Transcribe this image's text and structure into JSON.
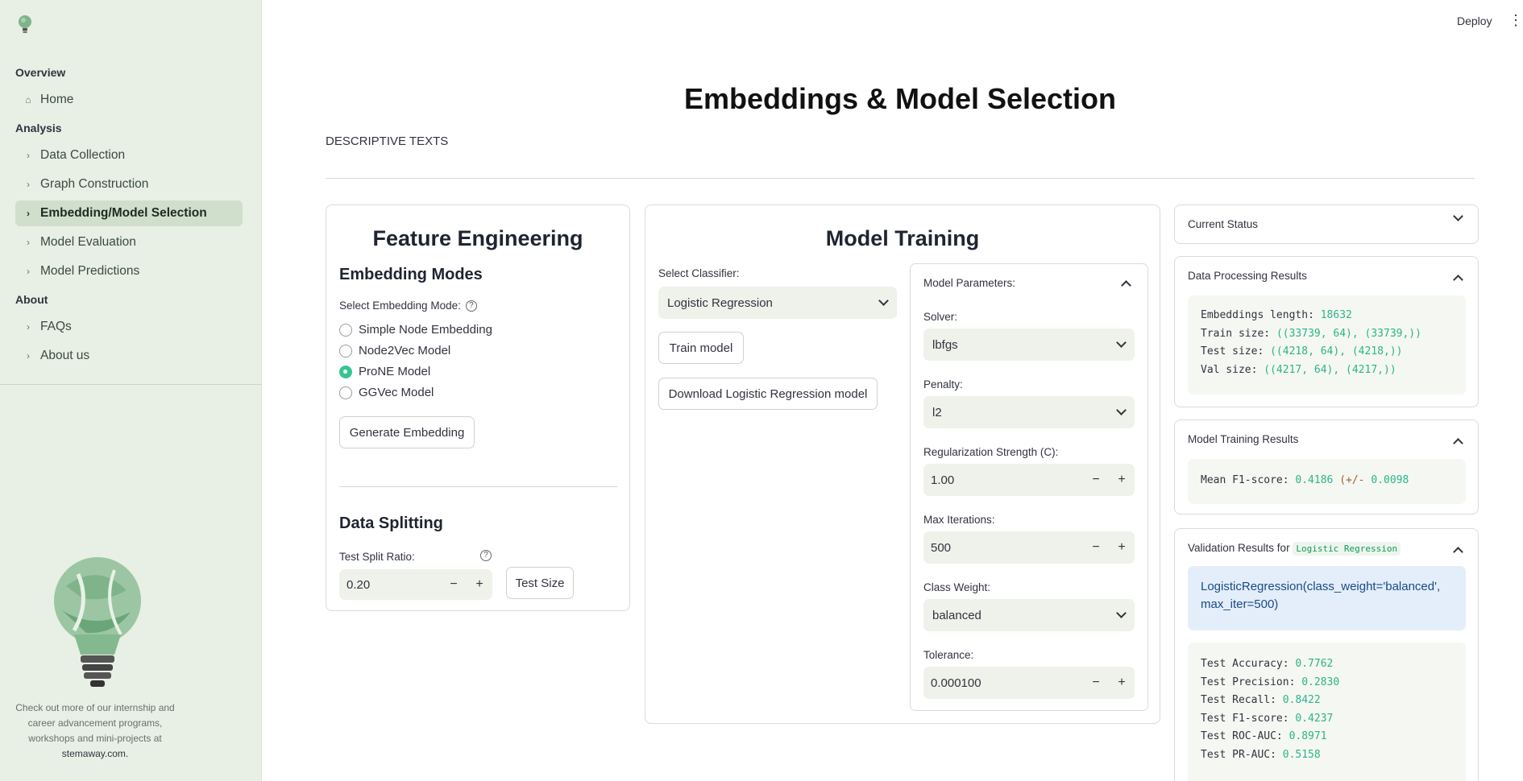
{
  "header": {
    "deploy_label": "Deploy",
    "menu_icon": "kebab-menu-icon"
  },
  "sidebar": {
    "logo_icon": "lightbulb-logo-icon",
    "sections": {
      "overview": "Overview",
      "analysis": "Analysis",
      "about": "About"
    },
    "items": [
      {
        "label": "Home",
        "icon": "home-icon"
      },
      {
        "label": "Data Collection",
        "icon": "chevron-right-icon"
      },
      {
        "label": "Graph Construction",
        "icon": "chevron-right-icon"
      },
      {
        "label": "Embedding/Model Selection",
        "icon": "chevron-right-icon",
        "active": true
      },
      {
        "label": "Model Evaluation",
        "icon": "chevron-right-icon"
      },
      {
        "label": "Model Predictions",
        "icon": "chevron-right-icon"
      },
      {
        "label": "FAQs",
        "icon": "chevron-right-icon"
      },
      {
        "label": "About us",
        "icon": "chevron-right-icon"
      }
    ],
    "note_text": "Check out more of our internship and career advancement programs, workshops and mini-projects at",
    "note_link": "stemaway.com."
  },
  "page": {
    "title": "Embeddings & Model Selection",
    "description": "DESCRIPTIVE TEXTS"
  },
  "feature_engineering": {
    "title": "Feature Engineering",
    "embedding_modes_heading": "Embedding Modes",
    "select_label": "Select Embedding Mode:",
    "options": [
      "Simple Node Embedding",
      "Node2Vec Model",
      "ProNE Model",
      "GGVec Model"
    ],
    "selected_option": "ProNE Model",
    "generate_button": "Generate Embedding",
    "data_splitting_heading": "Data Splitting",
    "test_split_label": "Test Split Ratio:",
    "test_split_value": "0.20",
    "test_size_button": "Test Size"
  },
  "model_training": {
    "title": "Model Training",
    "classifier_label": "Select Classifier:",
    "classifier_value": "Logistic Regression",
    "train_button": "Train model",
    "download_button": "Download Logistic Regression model",
    "params": {
      "heading": "Model Parameters:",
      "solver_label": "Solver:",
      "solver_value": "lbfgs",
      "penalty_label": "Penalty:",
      "penalty_value": "l2",
      "c_label": "Regularization Strength (C):",
      "c_value": "1.00",
      "max_iter_label": "Max Iterations:",
      "max_iter_value": "500",
      "class_weight_label": "Class Weight:",
      "class_weight_value": "balanced",
      "tol_label": "Tolerance:",
      "tol_value": "0.000100"
    }
  },
  "status": {
    "current_status": "Current Status",
    "data_processing_title": "Data Processing Results",
    "data_processing": {
      "embeddings_key": "Embeddings length",
      "embeddings_val": "18632",
      "train_key": "Train size",
      "train_val": "((33739, 64), (33739,))",
      "test_key": "Test size",
      "test_val": "((4218, 64), (4218,))",
      "val_key": "Val size",
      "val_val": "((4217, 64), (4217,))"
    },
    "model_training_title": "Model Training Results",
    "mean_f1_key": "Mean F1-score",
    "mean_f1_val": "0.4186",
    "mean_f1_pm": "(+/-",
    "mean_f1_std": "0.0098",
    "validation_title_prefix": "Validation Results for",
    "validation_model": "Logistic Regression",
    "model_repr": "LogisticRegression(class_weight='balanced', max_iter=500)",
    "metrics": [
      {
        "key": "Test Accuracy",
        "val": "0.7762"
      },
      {
        "key": "Test Precision",
        "val": "0.2830"
      },
      {
        "key": "Test Recall",
        "val": "0.8422"
      },
      {
        "key": "Test F1-score",
        "val": "0.4237"
      },
      {
        "key": "Test ROC-AUC",
        "val": "0.8971"
      },
      {
        "key": "Test PR-AUC",
        "val": "0.5158"
      }
    ]
  },
  "colors": {
    "accent": "#36c58f",
    "sidebar_bg": "#e8efe4",
    "input_bg": "#eef2ea"
  }
}
